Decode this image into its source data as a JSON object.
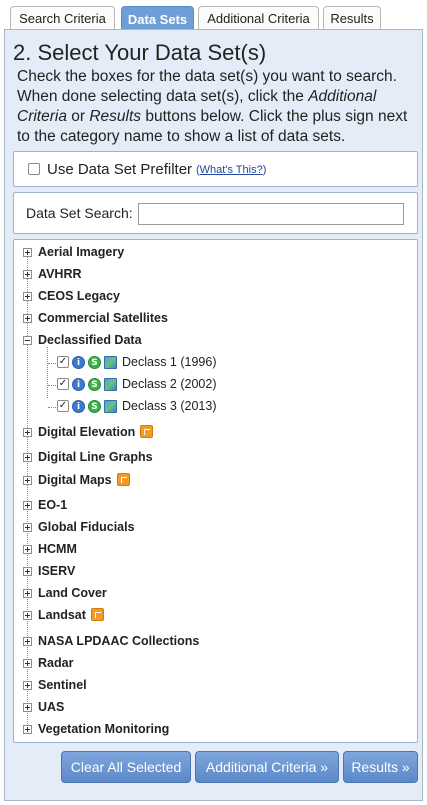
{
  "tabs": [
    {
      "label": "Search Criteria",
      "active": false
    },
    {
      "label": "Data Sets",
      "active": true
    },
    {
      "label": "Additional Criteria",
      "active": false
    },
    {
      "label": "Results",
      "active": false
    }
  ],
  "panel": {
    "title": "2. Select Your Data Set(s)",
    "instructions": {
      "part1": "Check the boxes for the data set(s) you want to search. When done selecting data set(s), click the ",
      "italic1": "Additional Criteria",
      "part2": " or ",
      "italic2": "Results",
      "part3": " buttons below. Click the plus sign next to the category name to show a list of data sets."
    }
  },
  "prefilter": {
    "label": "Use Data Set Prefilter",
    "checked": false,
    "help_open": "(",
    "help_link": "What's This?",
    "help_close": ")"
  },
  "search": {
    "label": "Data Set Search:",
    "value": "",
    "placeholder": ""
  },
  "categories": [
    {
      "label": "Aerial Imagery",
      "expanded": false,
      "badge": false
    },
    {
      "label": "AVHRR",
      "expanded": false,
      "badge": false
    },
    {
      "label": "CEOS Legacy",
      "expanded": false,
      "badge": false
    },
    {
      "label": "Commercial Satellites",
      "expanded": false,
      "badge": false
    },
    {
      "label": "Declassified Data",
      "expanded": true,
      "badge": false,
      "datasets": [
        {
          "label": "Declass 1 (1996)",
          "checked": true
        },
        {
          "label": "Declass 2 (2002)",
          "checked": true
        },
        {
          "label": "Declass 3 (2013)",
          "checked": true
        }
      ]
    },
    {
      "label": "Digital Elevation",
      "expanded": false,
      "badge": true
    },
    {
      "label": "Digital Line Graphs",
      "expanded": false,
      "badge": false
    },
    {
      "label": "Digital Maps",
      "expanded": false,
      "badge": true
    },
    {
      "label": "EO-1",
      "expanded": false,
      "badge": false
    },
    {
      "label": "Global Fiducials",
      "expanded": false,
      "badge": false
    },
    {
      "label": "HCMM",
      "expanded": false,
      "badge": false
    },
    {
      "label": "ISERV",
      "expanded": false,
      "badge": false
    },
    {
      "label": "Land Cover",
      "expanded": false,
      "badge": false
    },
    {
      "label": "Landsat",
      "expanded": false,
      "badge": true
    },
    {
      "label": "NASA LPDAAC Collections",
      "expanded": false,
      "badge": false
    },
    {
      "label": "Radar",
      "expanded": false,
      "badge": false
    },
    {
      "label": "Sentinel",
      "expanded": false,
      "badge": false
    },
    {
      "label": "UAS",
      "expanded": false,
      "badge": false
    },
    {
      "label": "Vegetation Monitoring",
      "expanded": false,
      "badge": false
    }
  ],
  "dataset_icons": {
    "info": "i",
    "s": "S",
    "info_icon": "info-icon",
    "s_icon": "s-icon",
    "map_icon": "map-preview-icon"
  },
  "buttons": {
    "clear": "Clear All Selected",
    "additional": "Additional Criteria »",
    "results": "Results »"
  },
  "colors": {
    "active_tab": "#6d9ed5",
    "panel_bg": "#e4edf7",
    "button": "#6a94d0",
    "badge": "#f19a2a"
  }
}
